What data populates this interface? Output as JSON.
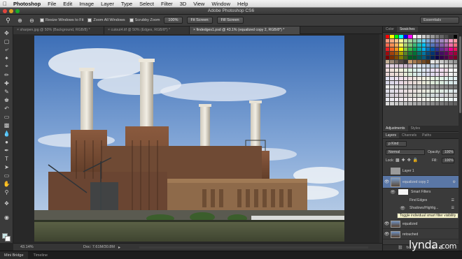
{
  "menubar": {
    "apple": "",
    "items": [
      "Photoshop",
      "File",
      "Edit",
      "Image",
      "Layer",
      "Type",
      "Select",
      "Filter",
      "3D",
      "View",
      "Window",
      "Help"
    ]
  },
  "window": {
    "title": "Adobe Photoshop CS6"
  },
  "options": {
    "resize_windows": "Resize Windows to Fit",
    "zoom_all": "Zoom All Windows",
    "scrubby": "Scrubby Zoom",
    "actual_pixels": "100%",
    "fit_screen": "Fit Screen",
    "fill_screen": "Fill Screen",
    "workspace": "Essentials"
  },
  "doc_tabs": [
    "sharpen.jpg @ 50% (Background, RGB/8) *",
    "cutout4.tif @ 50% (Edges, RGB/8*) *",
    "findedges1.psd @ 43.1% (equalized copy 2, RGB/8*) *"
  ],
  "status": {
    "zoom": "43.14%",
    "doc": "Doc: 7.61M/30.8M",
    "arrow": "▸"
  },
  "bottom": {
    "mini_bridge": "Mini Bridge",
    "timeline": "Timeline"
  },
  "watermark": {
    "brand": "lynda",
    "dot": ".",
    "tld": "com"
  },
  "swatches_panel": {
    "tabs": [
      "Color",
      "Swatches"
    ]
  },
  "adjustments_panel": {
    "tabs": [
      "Adjustments",
      "Styles"
    ]
  },
  "layers_panel": {
    "tabs": [
      "Layers",
      "Channels",
      "Paths"
    ],
    "kind_filter": "ρ Kind",
    "blend_mode": "Normal",
    "opacity_label": "Opacity:",
    "opacity_value": "100%",
    "lock_label": "Lock:",
    "fill_label": "Fill:",
    "fill_value": "100%",
    "layers": [
      {
        "name": "Layer 1"
      },
      {
        "name": "equalized copy 2"
      },
      {
        "name": "Smart Filters"
      },
      {
        "name": "Find Edges"
      },
      {
        "name": "Shadows/Highlig..."
      },
      {
        "name": "equalized"
      },
      {
        "name": "retouched"
      }
    ],
    "footer": [
      "⛓",
      "fx",
      "◘",
      "◐",
      "▭",
      "▣",
      "🗑"
    ]
  },
  "tooltip": "Toggle individual smart filter visibility",
  "colors": {
    "accent": "#5a77a6",
    "panel": "#3a3a3a",
    "canvas_bg": "#282828"
  }
}
